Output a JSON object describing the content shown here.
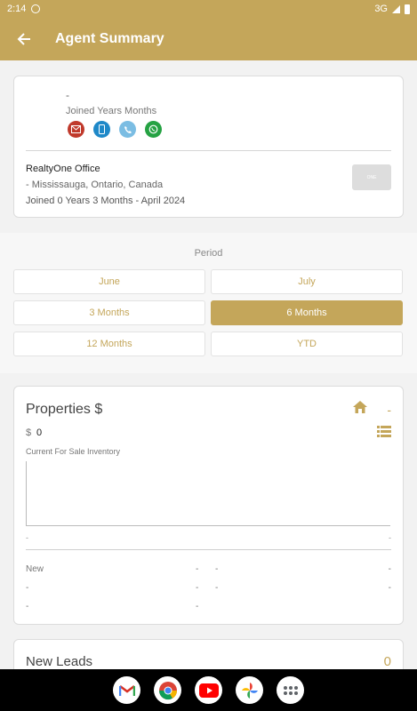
{
  "status_bar": {
    "time": "2:14",
    "network": "3G"
  },
  "app_bar": {
    "title": "Agent Summary"
  },
  "agent": {
    "name": "-",
    "joined": "Joined Years Months",
    "office_name": "RealtyOne Office",
    "office_address": " - Mississauga,  Ontario,  Canada",
    "office_joined": "Joined 0 Years 3 Months - April 2024",
    "office_logo_text": "ONE"
  },
  "period": {
    "label": "Period",
    "buttons": [
      "June",
      "July",
      "3 Months",
      "6 Months",
      "12 Months",
      "YTD"
    ],
    "selected": "6 Months"
  },
  "properties": {
    "title": "Properties  $",
    "header_value": "-",
    "currency": "$",
    "value": "0",
    "inventory_label": "Current For Sale Inventory",
    "axis_left": "-",
    "axis_right": "-",
    "stats": [
      "New",
      "-",
      "-",
      "-",
      "-",
      "-",
      "-",
      "-",
      "-",
      "-"
    ]
  },
  "new_leads": {
    "title": "New Leads",
    "count": "0"
  },
  "colors": {
    "accent": "#c4a65a"
  },
  "icons": [
    "back-arrow-icon",
    "mail-icon",
    "mobile-icon",
    "phone-icon",
    "whatsapp-icon",
    "home-icon",
    "list-icon"
  ],
  "nav_apps": [
    "Gmail",
    "Chrome",
    "YouTube",
    "Photos",
    "Apps"
  ]
}
